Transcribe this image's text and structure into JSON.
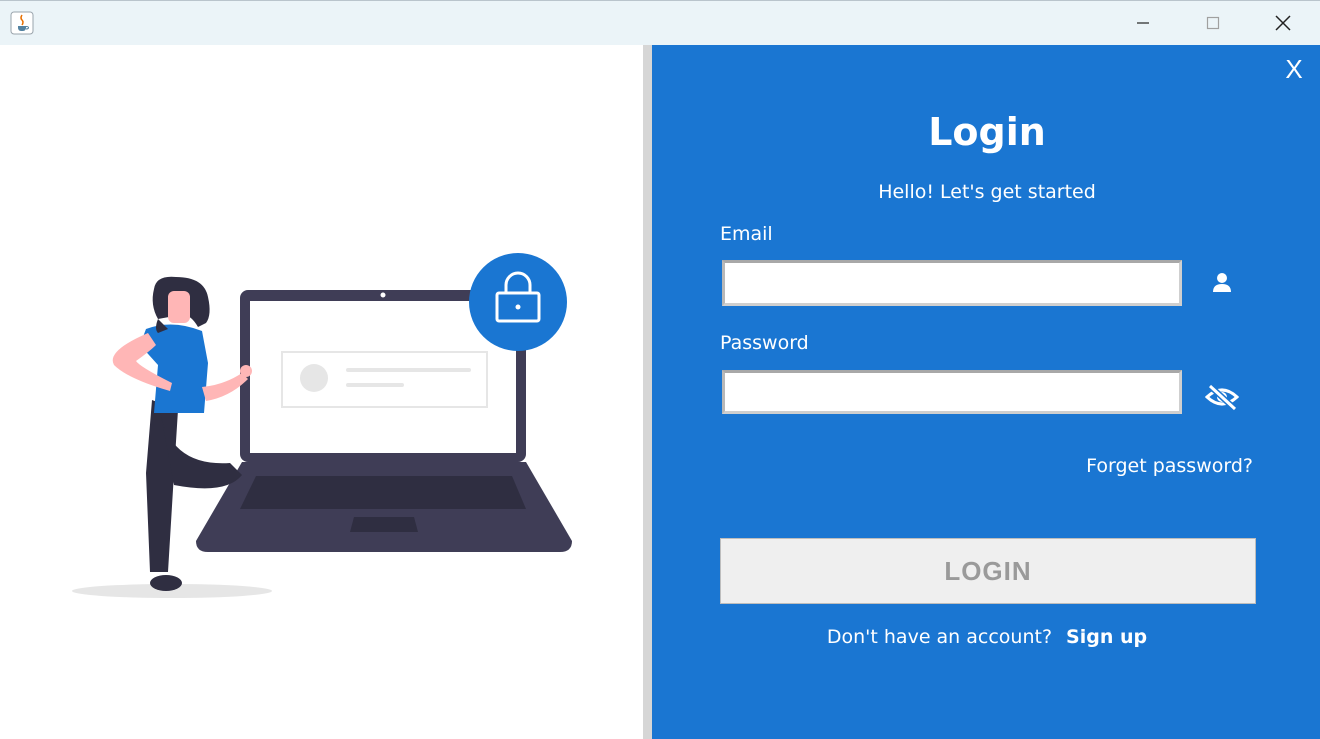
{
  "window": {
    "minimize_icon": "minimize-icon",
    "maximize_icon": "maximize-icon",
    "close_icon": "close-icon"
  },
  "login_panel": {
    "close_label": "X",
    "title": "Login",
    "subtitle": "Hello! Let's get started",
    "email_label": "Email",
    "email_value": "",
    "password_label": "Password",
    "password_value": "",
    "forgot_password": "Forget password?",
    "login_button": "LOGIN",
    "no_account_text": "Don't have an account?",
    "signup_link": "Sign up"
  },
  "colors": {
    "panel_background": "#1a76d2",
    "illustration_accent": "#1a76d2",
    "laptop_body": "#3f3d56",
    "person_dark": "#2f2e41",
    "skin": "#ffb6b6",
    "button_background": "#efefef",
    "button_text": "#9a9a9a"
  }
}
